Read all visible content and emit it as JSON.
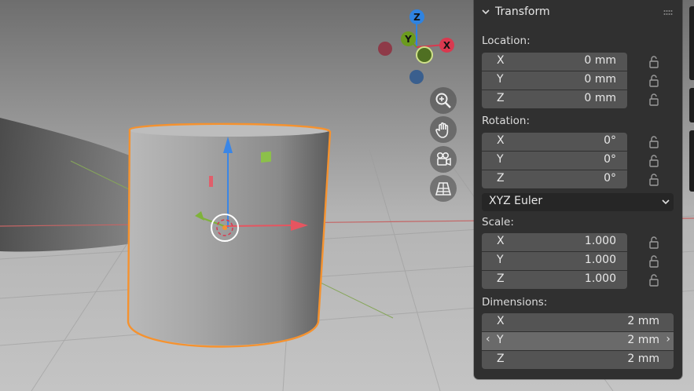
{
  "panel": {
    "title": "Transform",
    "location": {
      "label": "Location:",
      "fields": [
        {
          "axis": "X",
          "value": "0 mm"
        },
        {
          "axis": "Y",
          "value": "0 mm"
        },
        {
          "axis": "Z",
          "value": "0 mm"
        }
      ]
    },
    "rotation": {
      "label": "Rotation:",
      "fields": [
        {
          "axis": "X",
          "value": "0°"
        },
        {
          "axis": "Y",
          "value": "0°"
        },
        {
          "axis": "Z",
          "value": "0°"
        }
      ],
      "mode": "XYZ Euler"
    },
    "scale": {
      "label": "Scale:",
      "fields": [
        {
          "axis": "X",
          "value": "1.000"
        },
        {
          "axis": "Y",
          "value": "1.000"
        },
        {
          "axis": "Z",
          "value": "1.000"
        }
      ]
    },
    "dimensions": {
      "label": "Dimensions:",
      "fields": [
        {
          "axis": "X",
          "value": "2 mm"
        },
        {
          "axis": "Y",
          "value": "2 mm"
        },
        {
          "axis": "Z",
          "value": "2 mm"
        }
      ]
    }
  },
  "gizmo": {
    "x_label": "X",
    "y_label": "Y",
    "z_label": "Z",
    "x_color": "#d9394f",
    "y_color": "#6b9b1e",
    "z_color": "#2f83e0"
  },
  "colors": {
    "selection_outline": "#f5922f",
    "panel_bg": "#303030",
    "field_bg": "#545454"
  },
  "icons": [
    "zoom-icon",
    "hand-pan-icon",
    "camera-icon",
    "perspective-grid-icon",
    "lock-icon",
    "chevron-down-icon"
  ]
}
